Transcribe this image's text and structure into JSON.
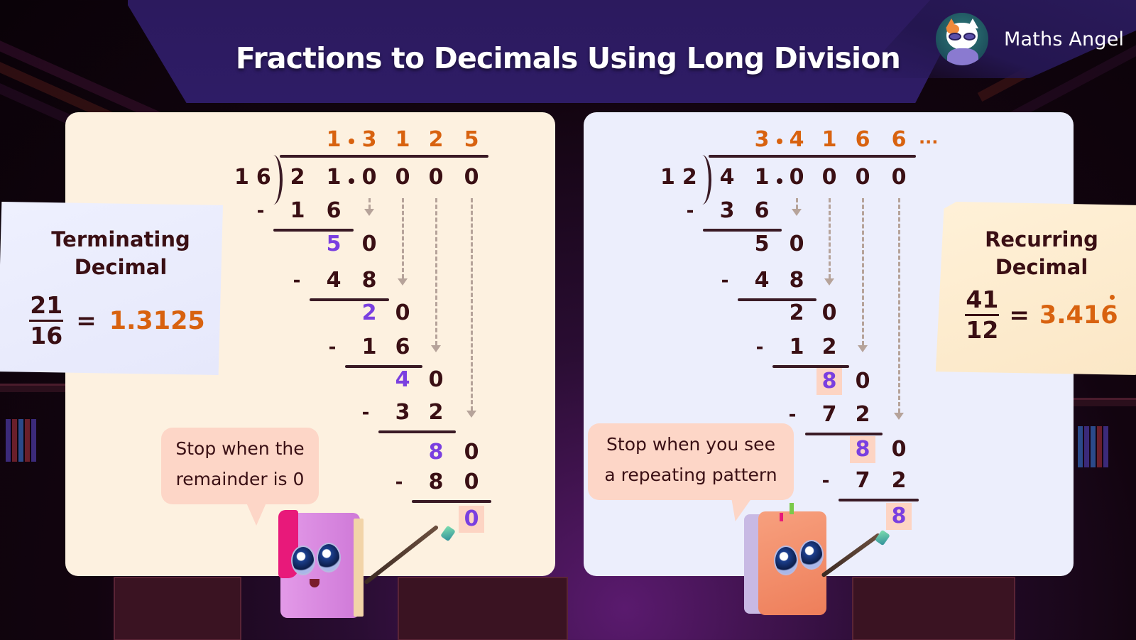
{
  "header": {
    "title": "Fractions to Decimals Using Long Division",
    "brand": {
      "name": "Maths Angel",
      "logo_icon": "cat-mascot-icon"
    }
  },
  "left_panel": {
    "note": {
      "heading_line1": "Terminating",
      "heading_line2": "Decimal",
      "numerator": "21",
      "denominator": "16",
      "equals": "=",
      "decimal": "1.3125"
    },
    "division": {
      "divisor": "16",
      "dividend_digits": [
        "2",
        "1",
        "0",
        "0",
        "0",
        "0"
      ],
      "quotient_digits": [
        "1",
        "3",
        "1",
        "2",
        "5"
      ],
      "steps": [
        {
          "subtract": [
            "1",
            "6"
          ],
          "remainder": [
            "5",
            "0"
          ],
          "highlight": "5"
        },
        {
          "subtract": [
            "4",
            "8"
          ],
          "remainder": [
            "2",
            "0"
          ],
          "highlight": "2"
        },
        {
          "subtract": [
            "1",
            "6"
          ],
          "remainder": [
            "4",
            "0"
          ],
          "highlight": "4"
        },
        {
          "subtract": [
            "3",
            "2"
          ],
          "remainder": [
            "8",
            "0"
          ],
          "highlight": "8"
        },
        {
          "subtract": [
            "8",
            "0"
          ],
          "remainder": [
            "0"
          ],
          "highlight": "0"
        }
      ],
      "minus_sign": "-"
    },
    "bubble": {
      "line1": "Stop when the",
      "line2": "remainder is 0"
    },
    "character": "pink-book-character"
  },
  "right_panel": {
    "note": {
      "heading_line1": "Recurring",
      "heading_line2": "Decimal",
      "numerator": "41",
      "denominator": "12",
      "equals": "=",
      "decimal": "3.416",
      "recurring_digit": "6"
    },
    "division": {
      "divisor": "12",
      "dividend_digits": [
        "4",
        "1",
        "0",
        "0",
        "0",
        "0"
      ],
      "quotient_digits": [
        "3",
        "4",
        "1",
        "6",
        "6"
      ],
      "quotient_continuation": "...",
      "steps": [
        {
          "subtract": [
            "3",
            "6"
          ],
          "remainder": [
            "5",
            "0"
          ]
        },
        {
          "subtract": [
            "4",
            "8"
          ],
          "remainder": [
            "2",
            "0"
          ]
        },
        {
          "subtract": [
            "1",
            "2"
          ],
          "remainder": [
            "8",
            "0"
          ],
          "highlight": "8"
        },
        {
          "subtract": [
            "7",
            "2"
          ],
          "remainder": [
            "8",
            "0"
          ],
          "highlight": "8"
        },
        {
          "subtract": [
            "7",
            "2"
          ],
          "remainder": [
            "8"
          ],
          "highlight": "8"
        }
      ],
      "minus_sign": "-"
    },
    "bubble": {
      "line1": "Stop when you see",
      "line2": "a repeating pattern"
    },
    "character": "orange-book-character"
  },
  "colors": {
    "quotient": "#d8620f",
    "highlight": "#7a3fe0",
    "text": "#3a0f14",
    "left_panel_bg": "#fdf1e0",
    "right_panel_bg": "#eceefc",
    "bubble_bg": "#fdd6c7",
    "header_bg": "#2e1c66"
  }
}
